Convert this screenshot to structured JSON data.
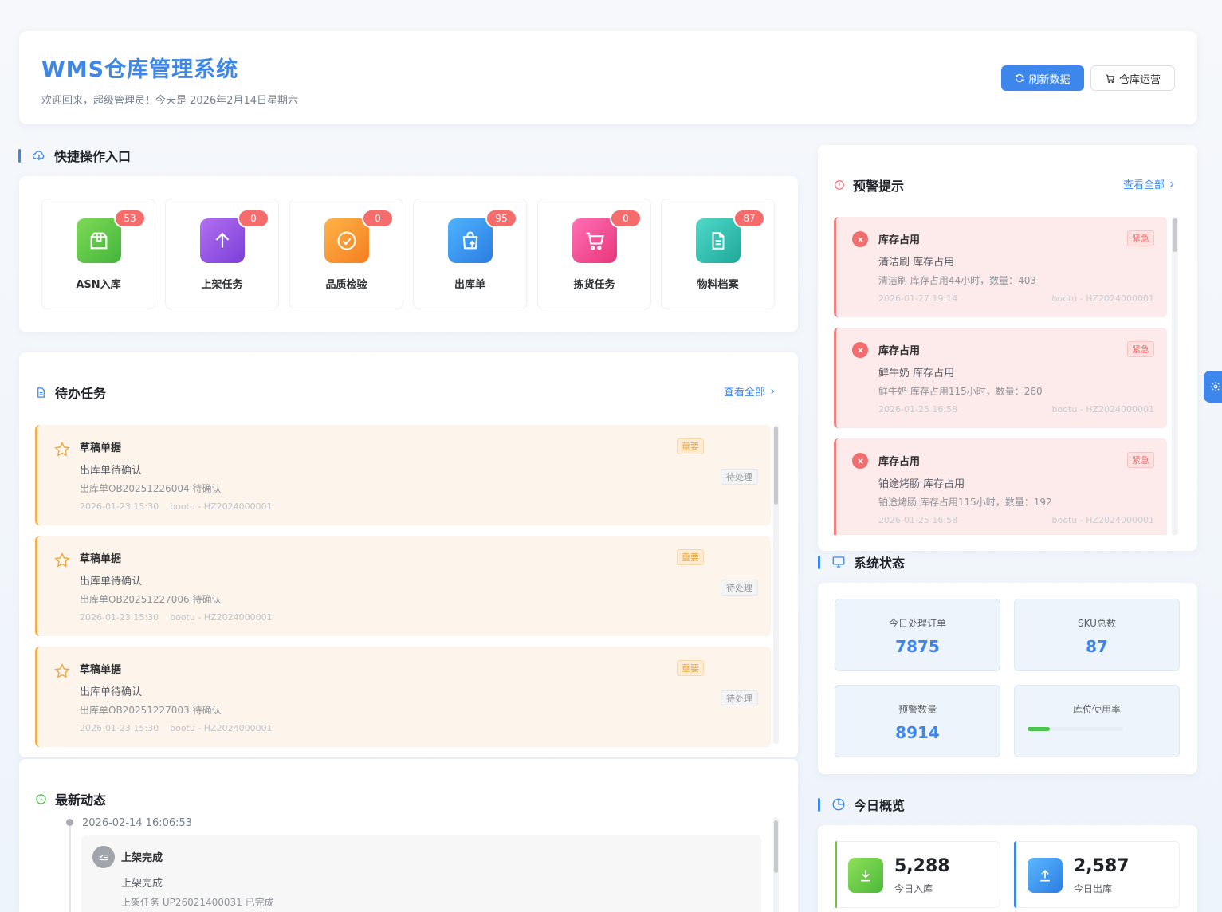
{
  "header": {
    "title": "WMS仓库管理系统",
    "welcome": "欢迎回来，超级管理员！今天是 2026年2月14日星期六",
    "refresh_label": "刷新数据",
    "ops_label": "仓库运营"
  },
  "quick": {
    "title": "快捷操作入口",
    "items": [
      {
        "label": "ASN入库",
        "badge": "53"
      },
      {
        "label": "上架任务",
        "badge": "0"
      },
      {
        "label": "品质检验",
        "badge": "0"
      },
      {
        "label": "出库单",
        "badge": "95"
      },
      {
        "label": "拣货任务",
        "badge": "0"
      },
      {
        "label": "物料档案",
        "badge": "87"
      }
    ]
  },
  "todo": {
    "title": "待办任务",
    "view_all": "查看全部",
    "items": [
      {
        "title": "草稿单据",
        "subtitle": "出库单待确认",
        "desc": "出库单OB20251226004 待确认",
        "meta": "2026-01-23 15:30    bootu - HZ2024000001",
        "priority": "重要",
        "status": "待处理"
      },
      {
        "title": "草稿单据",
        "subtitle": "出库单待确认",
        "desc": "出库单OB20251227006 待确认",
        "meta": "2026-01-23 15:30    bootu - HZ2024000001",
        "priority": "重要",
        "status": "待处理"
      },
      {
        "title": "草稿单据",
        "subtitle": "出库单待确认",
        "desc": "出库单OB20251227003 待确认",
        "meta": "2026-01-23 15:30    bootu - HZ2024000001",
        "priority": "重要",
        "status": "待处理"
      }
    ]
  },
  "activity": {
    "title": "最新动态",
    "time": "2026-02-14 16:06:53",
    "item_title": "上架完成",
    "item_subtitle": "上架完成",
    "item_desc": "上架任务 UP26021400031 已完成"
  },
  "alerts": {
    "title": "预警提示",
    "view_all": "查看全部",
    "items": [
      {
        "title": "库存占用",
        "subtitle": "清洁刷 库存占用",
        "desc": "清洁刷 库存占用44小时，数量：403",
        "time": "2026-01-27 19:14",
        "user": "bootu - HZ2024000001",
        "level": "紧急"
      },
      {
        "title": "库存占用",
        "subtitle": "鲜牛奶 库存占用",
        "desc": "鲜牛奶 库存占用115小时，数量：260",
        "time": "2026-01-25 16:58",
        "user": "bootu - HZ2024000001",
        "level": "紧急"
      },
      {
        "title": "库存占用",
        "subtitle": "铂途烤肠 库存占用",
        "desc": "铂途烤肠 库存占用115小时，数量：192",
        "time": "2026-01-25 16:58",
        "user": "bootu - HZ2024000001",
        "level": "紧急"
      }
    ]
  },
  "system": {
    "title": "系统状态",
    "orders_label": "今日处理订单",
    "orders_value": "7875",
    "sku_label": "SKU总数",
    "sku_value": "87",
    "warn_label": "预警数量",
    "warn_value": "8914",
    "usage_label": "库位使用率",
    "usage_fraction": 0.23
  },
  "today": {
    "title": "今日概览",
    "inbound_value": "5,288",
    "inbound_label": "今日入库",
    "outbound_value": "2,587",
    "outbound_label": "今日出库"
  },
  "colors": {
    "accent": "#3d87ec",
    "badge": "#f56c6c",
    "warning": "#f0b050",
    "danger": "#f06e6e",
    "success": "#4cc24c"
  },
  "icons": {
    "quick": [
      "package-icon",
      "arrow-up-icon",
      "check-circle-icon",
      "shopping-bag-icon",
      "cart-icon",
      "document-icon"
    ],
    "float_button": "gear-icon"
  }
}
